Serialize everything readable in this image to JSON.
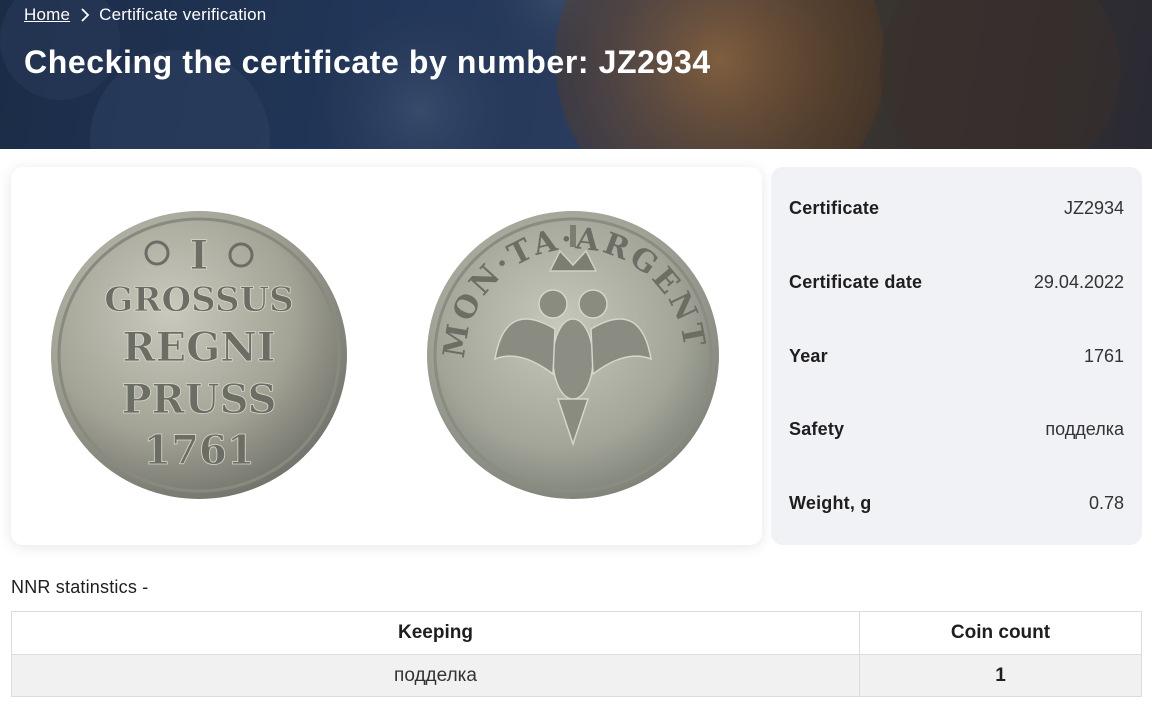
{
  "breadcrumb": {
    "home": "Home",
    "current": "Certificate verification"
  },
  "page": {
    "title": "Checking the certificate by number: JZ2934"
  },
  "certificate": {
    "rows": [
      {
        "label": "Certificate",
        "value": "JZ2934"
      },
      {
        "label": "Certificate date",
        "value": "29.04.2022"
      },
      {
        "label": "Year",
        "value": "1761"
      },
      {
        "label": "Safety",
        "value": "подделка"
      },
      {
        "label": "Weight, g",
        "value": "0.78"
      }
    ]
  },
  "coin": {
    "obverse_lines": [
      "I",
      "GROSSUS",
      "REGNI",
      "PRUSS",
      "1761"
    ],
    "reverse_legend": "MON·TA·ARGENTEA"
  },
  "stats": {
    "label": "NNR statinstics -",
    "headers": [
      "Keeping",
      "Coin count"
    ],
    "rows": [
      {
        "keeping": "подделка",
        "count": "1"
      }
    ]
  },
  "colors": {
    "banner": "#22375a",
    "panel_bg": "#f1f2f6",
    "coin_silver": "#a8a89c"
  }
}
